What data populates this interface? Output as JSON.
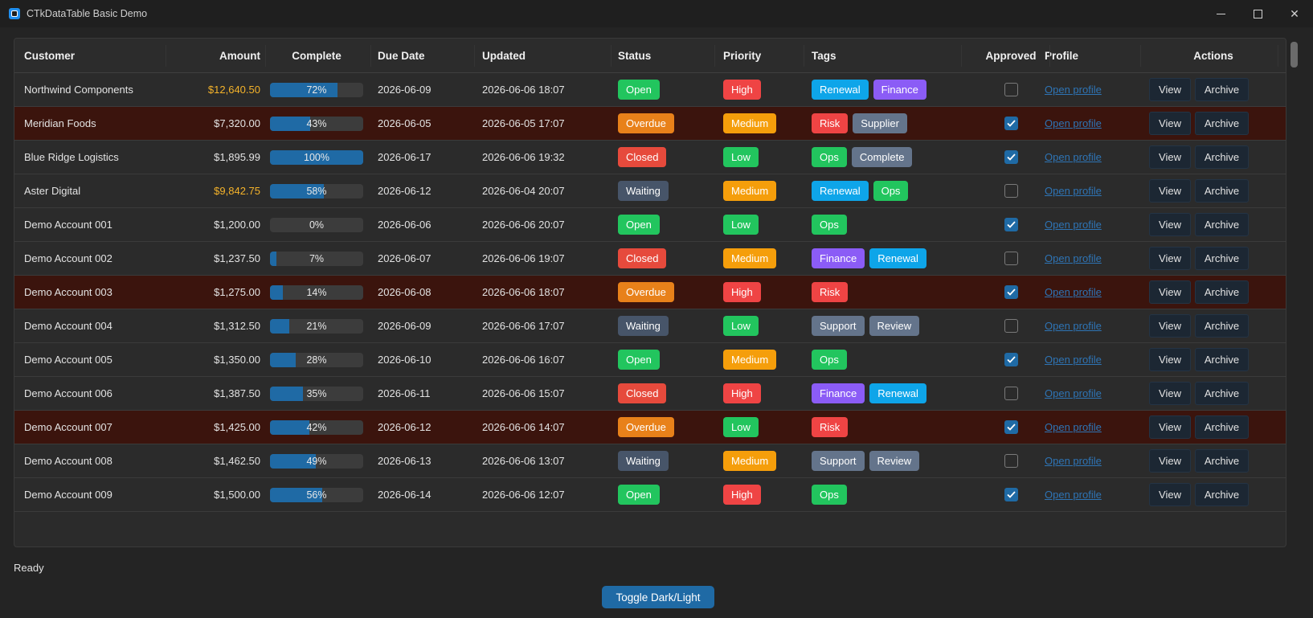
{
  "window": {
    "title": "CTkDataTable Basic Demo"
  },
  "columns": [
    "Customer",
    "Amount",
    "Complete",
    "Due Date",
    "Updated",
    "Status",
    "Priority",
    "Tags",
    "Approved",
    "Profile",
    "Actions"
  ],
  "colors": {
    "status": {
      "Open": "#22c55e",
      "Overdue": "#e8811a",
      "Closed": "#e64a3c",
      "Waiting": "#475569"
    },
    "priority": {
      "High": "#ef4444",
      "Medium": "#f59e0b",
      "Low": "#22c55e"
    },
    "tags": {
      "Renewal": "#0ea5e9",
      "Finance": "#8b5cf6",
      "Risk": "#ef4444",
      "Supplier": "#64748b",
      "Ops": "#22c55e",
      "Complete": "#64748b",
      "Support": "#64748b",
      "Review": "#64748b"
    },
    "progress_fill": "#1f6aa5",
    "overdue_row": "#3b140d",
    "amount_highlight": "#f5b32a"
  },
  "rows": [
    {
      "customer": "Northwind Components",
      "amount": "$12,640.50",
      "highlight": true,
      "complete": 72,
      "complete_label": "72%",
      "due": "2026-06-09",
      "updated": "2026-06-06 18:07",
      "status": "Open",
      "priority": "High",
      "tags": [
        "Renewal",
        "Finance"
      ],
      "approved": false,
      "profile": "Open profile",
      "actions": [
        "View",
        "Archive"
      ]
    },
    {
      "customer": "Meridian Foods",
      "amount": "$7,320.00",
      "highlight": false,
      "complete": 43,
      "complete_label": "43%",
      "due": "2026-06-05",
      "updated": "2026-06-05 17:07",
      "status": "Overdue",
      "priority": "Medium",
      "tags": [
        "Risk",
        "Supplier"
      ],
      "approved": true,
      "profile": "Open profile",
      "actions": [
        "View",
        "Archive"
      ]
    },
    {
      "customer": "Blue Ridge Logistics",
      "amount": "$1,895.99",
      "highlight": false,
      "complete": 100,
      "complete_label": "100%",
      "due": "2026-06-17",
      "updated": "2026-06-06 19:32",
      "status": "Closed",
      "priority": "Low",
      "tags": [
        "Ops",
        "Complete"
      ],
      "approved": true,
      "profile": "Open profile",
      "actions": [
        "View",
        "Archive"
      ]
    },
    {
      "customer": "Aster Digital",
      "amount": "$9,842.75",
      "highlight": true,
      "complete": 58,
      "complete_label": "58%",
      "due": "2026-06-12",
      "updated": "2026-06-04 20:07",
      "status": "Waiting",
      "priority": "Medium",
      "tags": [
        "Renewal",
        "Ops"
      ],
      "approved": false,
      "profile": "Open profile",
      "actions": [
        "View",
        "Archive"
      ]
    },
    {
      "customer": "Demo Account 001",
      "amount": "$1,200.00",
      "highlight": false,
      "complete": 0,
      "complete_label": "0%",
      "due": "2026-06-06",
      "updated": "2026-06-06 20:07",
      "status": "Open",
      "priority": "Low",
      "tags": [
        "Ops"
      ],
      "approved": true,
      "profile": "Open profile",
      "actions": [
        "View",
        "Archive"
      ]
    },
    {
      "customer": "Demo Account 002",
      "amount": "$1,237.50",
      "highlight": false,
      "complete": 7,
      "complete_label": "7%",
      "due": "2026-06-07",
      "updated": "2026-06-06 19:07",
      "status": "Closed",
      "priority": "Medium",
      "tags": [
        "Finance",
        "Renewal"
      ],
      "approved": false,
      "profile": "Open profile",
      "actions": [
        "View",
        "Archive"
      ]
    },
    {
      "customer": "Demo Account 003",
      "amount": "$1,275.00",
      "highlight": false,
      "complete": 14,
      "complete_label": "14%",
      "due": "2026-06-08",
      "updated": "2026-06-06 18:07",
      "status": "Overdue",
      "priority": "High",
      "tags": [
        "Risk"
      ],
      "approved": true,
      "profile": "Open profile",
      "actions": [
        "View",
        "Archive"
      ]
    },
    {
      "customer": "Demo Account 004",
      "amount": "$1,312.50",
      "highlight": false,
      "complete": 21,
      "complete_label": "21%",
      "due": "2026-06-09",
      "updated": "2026-06-06 17:07",
      "status": "Waiting",
      "priority": "Low",
      "tags": [
        "Support",
        "Review"
      ],
      "approved": false,
      "profile": "Open profile",
      "actions": [
        "View",
        "Archive"
      ]
    },
    {
      "customer": "Demo Account 005",
      "amount": "$1,350.00",
      "highlight": false,
      "complete": 28,
      "complete_label": "28%",
      "due": "2026-06-10",
      "updated": "2026-06-06 16:07",
      "status": "Open",
      "priority": "Medium",
      "tags": [
        "Ops"
      ],
      "approved": true,
      "profile": "Open profile",
      "actions": [
        "View",
        "Archive"
      ]
    },
    {
      "customer": "Demo Account 006",
      "amount": "$1,387.50",
      "highlight": false,
      "complete": 35,
      "complete_label": "35%",
      "due": "2026-06-11",
      "updated": "2026-06-06 15:07",
      "status": "Closed",
      "priority": "High",
      "tags": [
        "Finance",
        "Renewal"
      ],
      "approved": false,
      "profile": "Open profile",
      "actions": [
        "View",
        "Archive"
      ]
    },
    {
      "customer": "Demo Account 007",
      "amount": "$1,425.00",
      "highlight": false,
      "complete": 42,
      "complete_label": "42%",
      "due": "2026-06-12",
      "updated": "2026-06-06 14:07",
      "status": "Overdue",
      "priority": "Low",
      "tags": [
        "Risk"
      ],
      "approved": true,
      "profile": "Open profile",
      "actions": [
        "View",
        "Archive"
      ]
    },
    {
      "customer": "Demo Account 008",
      "amount": "$1,462.50",
      "highlight": false,
      "complete": 49,
      "complete_label": "49%",
      "due": "2026-06-13",
      "updated": "2026-06-06 13:07",
      "status": "Waiting",
      "priority": "Medium",
      "tags": [
        "Support",
        "Review"
      ],
      "approved": false,
      "profile": "Open profile",
      "actions": [
        "View",
        "Archive"
      ]
    },
    {
      "customer": "Demo Account 009",
      "amount": "$1,500.00",
      "highlight": false,
      "complete": 56,
      "complete_label": "56%",
      "due": "2026-06-14",
      "updated": "2026-06-06 12:07",
      "status": "Open",
      "priority": "High",
      "tags": [
        "Ops"
      ],
      "approved": true,
      "profile": "Open profile",
      "actions": [
        "View",
        "Archive"
      ]
    }
  ],
  "footer": {
    "status": "Ready",
    "toggle_label": "Toggle Dark/Light"
  }
}
